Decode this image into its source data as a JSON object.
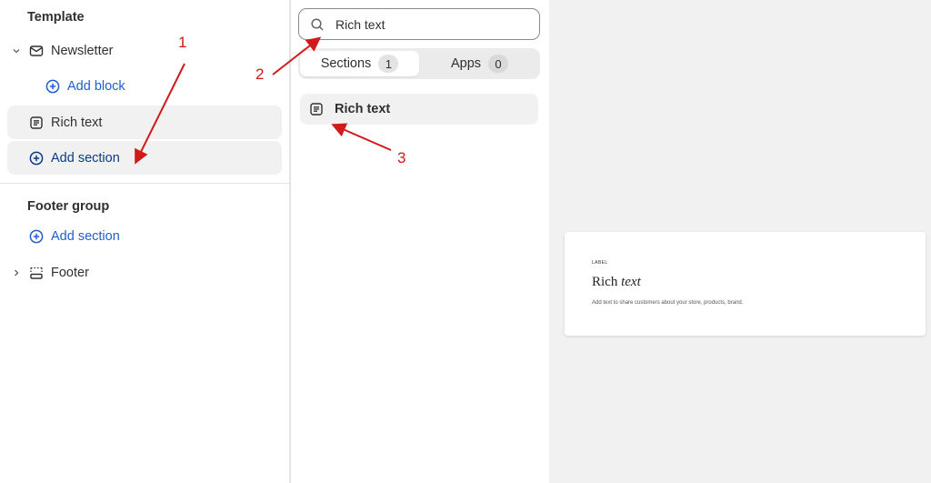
{
  "sidebar": {
    "template_heading": "Template",
    "newsletter_label": "Newsletter",
    "add_block_label": "Add block",
    "rich_text_label": "Rich text",
    "add_section_label": "Add section",
    "footer_group_heading": "Footer group",
    "footer_add_section_label": "Add section",
    "footer_label": "Footer"
  },
  "picker": {
    "search_value": "Rich text",
    "tabs": [
      {
        "label": "Sections",
        "count": "1"
      },
      {
        "label": "Apps",
        "count": "0"
      }
    ],
    "result_label": "Rich text"
  },
  "preview": {
    "label": "LABEL",
    "title_plain": "Rich",
    "title_italic": "text",
    "description": "Add text to share customers about your store, products, brand."
  },
  "annotations": {
    "one": "1",
    "two": "2",
    "three": "3",
    "color": "#d11a1a"
  },
  "colors": {
    "accent_blue": "#1f5fc9",
    "selected_bg": "#f1f1f1",
    "preview_bg": "#f1f1f1"
  },
  "icons": {
    "newsletter": "envelope-icon",
    "add": "plus-circle-icon",
    "rich_text": "text-block-icon",
    "footer": "footer-layout-icon",
    "search": "search-icon",
    "expand": "chevron-down-icon",
    "collapse": "chevron-right-icon"
  }
}
